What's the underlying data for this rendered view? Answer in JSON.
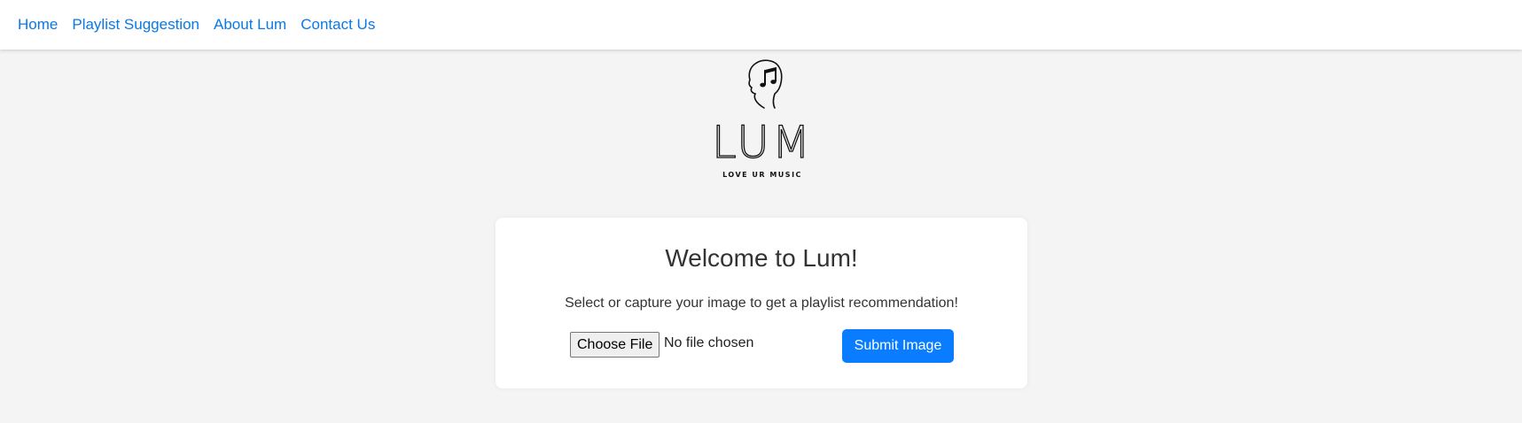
{
  "nav": {
    "items": [
      {
        "label": "Home"
      },
      {
        "label": "Playlist Suggestion"
      },
      {
        "label": "About Lum"
      },
      {
        "label": "Contact Us"
      }
    ]
  },
  "logo": {
    "wordmark": "LUM",
    "tagline": "LOVE UR MUSIC"
  },
  "card": {
    "title": "Welcome to Lum!",
    "description": "Select or capture your image to get a playlist recommendation!",
    "file_button_label": "Choose File",
    "file_status": "No file chosen",
    "submit_label": "Submit Image"
  },
  "colors": {
    "link": "#0a78e6",
    "primary_button": "#0a7cff",
    "page_background": "#f4f4f4"
  }
}
